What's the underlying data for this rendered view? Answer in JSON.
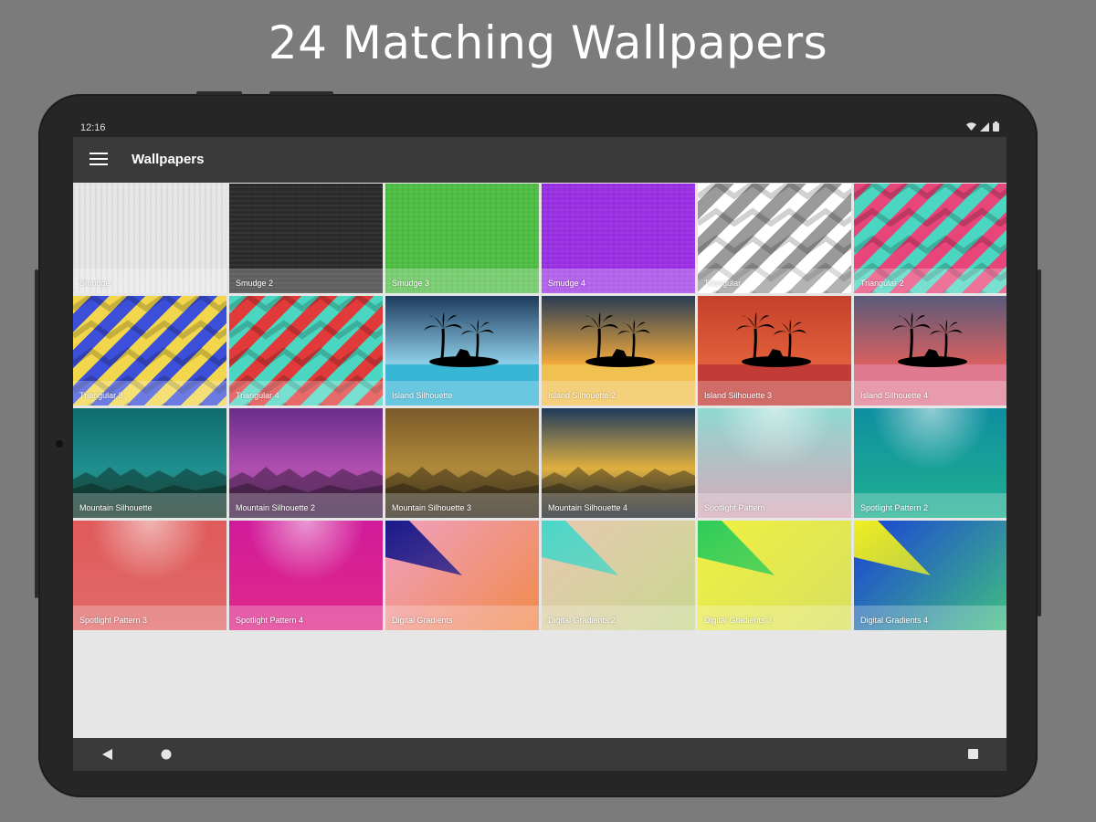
{
  "headline": "24 Matching Wallpapers",
  "status_bar": {
    "time": "12:16"
  },
  "app_bar": {
    "title": "Wallpapers",
    "menu_icon": "hamburger-menu-icon"
  },
  "wallpapers": [
    {
      "label": "Smudge",
      "style": "smudge",
      "colors": [
        "#e6e6e6",
        "#b9b9b9"
      ]
    },
    {
      "label": "Smudge 2",
      "style": "smudge",
      "colors": [
        "#2a2a2a",
        "#111111"
      ]
    },
    {
      "label": "Smudge 3",
      "style": "smudge",
      "colors": [
        "#4fbf44",
        "#c3d84a"
      ]
    },
    {
      "label": "Smudge 4",
      "style": "smudge",
      "colors": [
        "#9b2fe6",
        "#4b6be0"
      ]
    },
    {
      "label": "Triangular",
      "style": "triangular",
      "colors": [
        "#ffffff",
        "#9a9a9a"
      ]
    },
    {
      "label": "Triangular 2",
      "style": "triangular",
      "colors": [
        "#e8457a",
        "#4ad6c0"
      ]
    },
    {
      "label": "Triangular 3",
      "style": "triangular",
      "colors": [
        "#f2d64b",
        "#3b4fd8"
      ]
    },
    {
      "label": "Triangular 4",
      "style": "triangular",
      "colors": [
        "#4ad6c0",
        "#e03a3a"
      ]
    },
    {
      "label": "Island Silhouette",
      "style": "island",
      "colors": [
        "#1f3b5e",
        "#8fd0e8",
        "#39b5d6"
      ]
    },
    {
      "label": "Island Silhouette 2",
      "style": "island",
      "colors": [
        "#2a3d55",
        "#f2a93b",
        "#f0c050"
      ]
    },
    {
      "label": "Island Silhouette 3",
      "style": "island",
      "colors": [
        "#c4402c",
        "#e2603a",
        "#c23b36"
      ]
    },
    {
      "label": "Island Silhouette 4",
      "style": "island",
      "colors": [
        "#5a5a7a",
        "#d86060",
        "#e07a90"
      ]
    },
    {
      "label": "Mountain Silhouette",
      "style": "mountain",
      "colors": [
        "#0f6b6b",
        "#1f8f8f",
        "#2e7a5a"
      ]
    },
    {
      "label": "Mountain Silhouette 2",
      "style": "mountain",
      "colors": [
        "#6a2d8a",
        "#b04fb0",
        "#8a4a9a"
      ]
    },
    {
      "label": "Mountain Silhouette 3",
      "style": "mountain",
      "colors": [
        "#7a5a2a",
        "#b08a3a",
        "#6a5a3a"
      ]
    },
    {
      "label": "Mountain Silhouette 4",
      "style": "mountain",
      "colors": [
        "#1f3b5e",
        "#e0b040",
        "#3a4a5a"
      ]
    },
    {
      "label": "Spotlight Pattern",
      "style": "spotlight",
      "colors": [
        "#8fd8d0",
        "#d8a8b8"
      ]
    },
    {
      "label": "Spotlight Pattern 2",
      "style": "spotlight",
      "colors": [
        "#0f8fa0",
        "#1fb090"
      ]
    },
    {
      "label": "Spotlight Pattern 3",
      "style": "spotlight",
      "colors": [
        "#e05a5a",
        "#e06a6a"
      ]
    },
    {
      "label": "Spotlight Pattern 4",
      "style": "spotlight",
      "colors": [
        "#d01a9a",
        "#e02a8a"
      ]
    },
    {
      "label": "Digital Gradients",
      "style": "gradient",
      "colors": [
        "#1a1a8a",
        "#f0a0c0",
        "#f08a4a"
      ]
    },
    {
      "label": "Digital Gradients 2",
      "style": "gradient",
      "colors": [
        "#4ad6c8",
        "#e8c8b0",
        "#c8d890"
      ]
    },
    {
      "label": "Digital Gradients 3",
      "style": "gradient",
      "colors": [
        "#2ecc5a",
        "#f0f040",
        "#d8e060"
      ]
    },
    {
      "label": "Digital Gradients 4",
      "style": "gradient",
      "colors": [
        "#f0f020",
        "#1a40d8",
        "#40c080"
      ]
    }
  ],
  "nav_bar": {
    "back_icon": "back-triangle-icon",
    "home_icon": "home-circle-icon",
    "recents_icon": "recents-square-icon"
  }
}
